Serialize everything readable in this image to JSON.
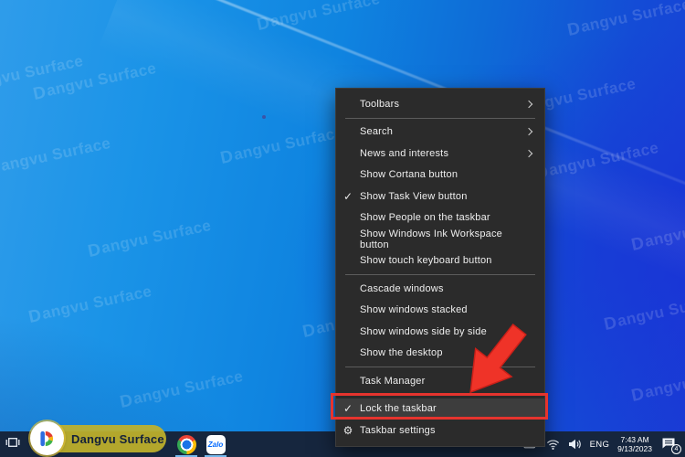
{
  "desktop": {
    "watermark_text": "Dangvu Surface"
  },
  "context_menu": {
    "items": [
      {
        "label": "Toolbars",
        "submenu": true,
        "separator_after": true
      },
      {
        "label": "Search",
        "submenu": true
      },
      {
        "label": "News and interests",
        "submenu": true
      },
      {
        "label": "Show Cortana button"
      },
      {
        "label": "Show Task View button",
        "checked": true
      },
      {
        "label": "Show People on the taskbar"
      },
      {
        "label": "Show Windows Ink Workspace button"
      },
      {
        "label": "Show touch keyboard button",
        "separator_after": true
      },
      {
        "label": "Cascade windows"
      },
      {
        "label": "Show windows stacked"
      },
      {
        "label": "Show windows side by side"
      },
      {
        "label": "Show the desktop",
        "separator_after": true
      },
      {
        "label": "Task Manager",
        "separator_after": true
      },
      {
        "label": "Lock the taskbar",
        "checked": true,
        "highlighted": true
      },
      {
        "label": "Taskbar settings",
        "gear": true
      }
    ],
    "check_glyph": "✓",
    "gear_glyph": "⚙"
  },
  "annotation": {
    "highlight_color": "#e6342e"
  },
  "taskbar": {
    "brand_label": "Dangvu Surface",
    "apps": [
      {
        "icon": "task-view-icon"
      },
      {
        "icon": "chrome-icon"
      },
      {
        "icon": "zalo-icon",
        "label": "Zalo"
      }
    ],
    "tray": {
      "language": "ENG",
      "time": "7:43 AM",
      "date": "9/13/2023",
      "notification_count": "4"
    }
  }
}
